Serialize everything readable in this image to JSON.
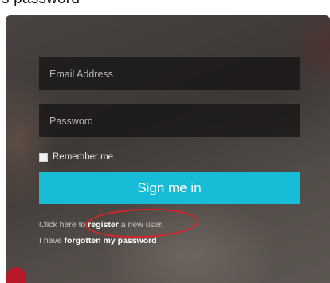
{
  "top_text": "s password",
  "login": {
    "email_placeholder": "Email Address",
    "password_placeholder": "Password",
    "remember_label": "Remember me",
    "signin_label": "Sign me in"
  },
  "register_line": {
    "prefix": "Click here to ",
    "link": "register",
    "suffix": " a new user."
  },
  "forgot_line": {
    "prefix": "I have ",
    "link": "forgotten my password"
  },
  "colors": {
    "signin_button": "#17bcd6",
    "annotation": "#d8232a"
  }
}
